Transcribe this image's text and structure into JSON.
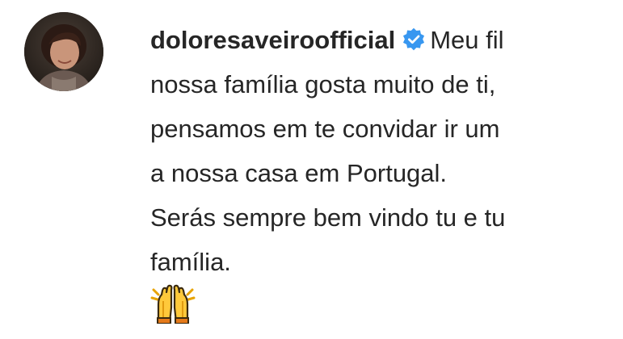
{
  "comment": {
    "username": "doloresaveiroofficial",
    "verified_icon": "verified-badge-icon",
    "text_lines": [
      "Meu fil",
      "nossa família gosta muito de ti,",
      "pensamos em te convidar ir um",
      "a nossa casa em Portugal.",
      "Serás sempre bem vindo tu e tu",
      "família."
    ],
    "emoji_icon": "raising-hands-emoji-icon"
  },
  "colors": {
    "text": "#262626",
    "verified_blue": "#3897f0",
    "background": "#ffffff"
  }
}
